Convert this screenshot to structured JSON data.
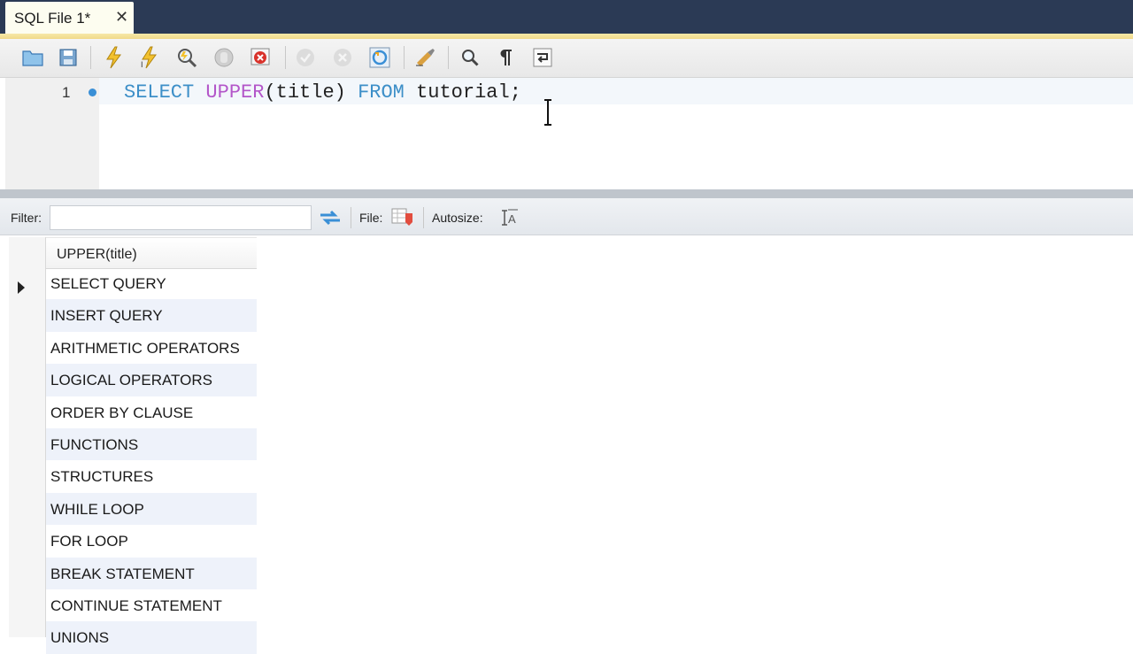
{
  "tab": {
    "title": "SQL File 1*",
    "close": "✕"
  },
  "editor": {
    "line_number": "1",
    "tokens": {
      "select": "SELECT",
      "upper": "UPPER",
      "args": "(title)",
      "from": "FROM",
      "table": "tutorial;"
    }
  },
  "result_toolbar": {
    "filter_label": "Filter:",
    "filter_value": "",
    "file_label": "File:",
    "autosize_label": "Autosize:"
  },
  "grid": {
    "column": "UPPER(title)",
    "rows": [
      "SELECT QUERY",
      "INSERT QUERY",
      "ARITHMETIC OPERATORS",
      "LOGICAL OPERATORS",
      "ORDER BY CLAUSE",
      "FUNCTIONS",
      "STRUCTURES",
      "WHILE LOOP",
      "FOR LOOP",
      "BREAK STATEMENT",
      "CONTINUE STATEMENT",
      "UNIONS"
    ]
  },
  "colors": {
    "keyword": "#3d8fc8",
    "function": "#b356c9",
    "tabbar": "#2b3a55"
  }
}
